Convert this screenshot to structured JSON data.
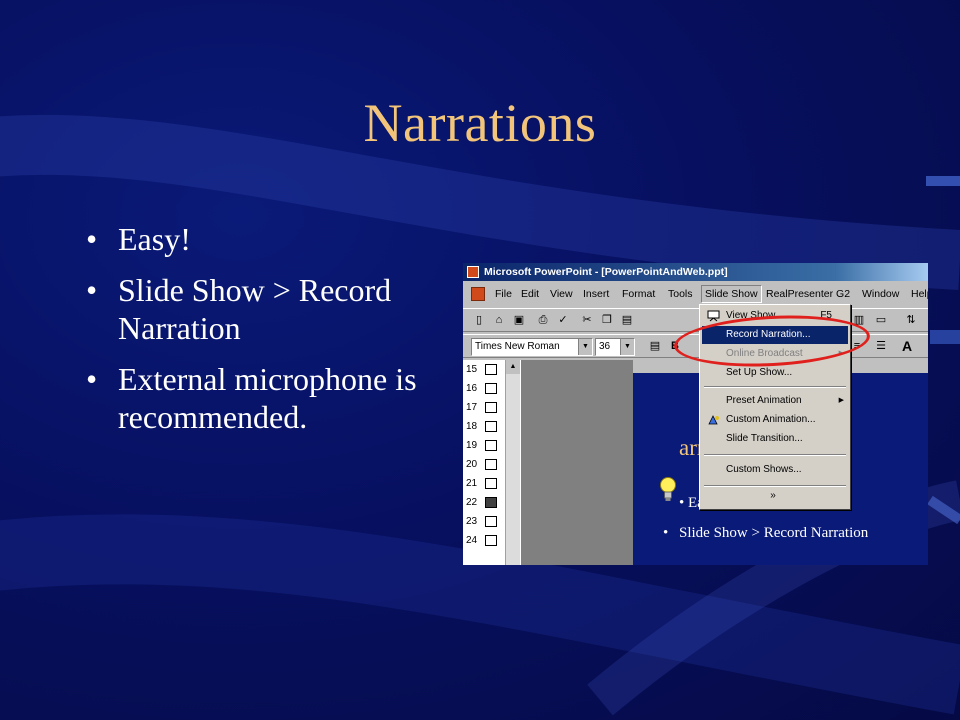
{
  "slide": {
    "title": "Narrations",
    "bullets": [
      {
        "bullet": "•",
        "text": "Easy!"
      },
      {
        "bullet": "•",
        "text": "Slide Show > Record Narration"
      },
      {
        "bullet": "•",
        "text": "External microphone is recommended."
      }
    ]
  },
  "screenshot": {
    "window_title": "Microsoft PowerPoint - [PowerPointAndWeb.ppt]",
    "menus": [
      "File",
      "Edit",
      "View",
      "Insert",
      "Format",
      "Tools",
      "Slide Show",
      "RealPresenter G2",
      "Window",
      "Help"
    ],
    "active_menu": "Slide Show",
    "font_name": "Times New Roman",
    "font_size": "36",
    "bold_label": "B",
    "grow_font_glyph": "A",
    "slide_numbers": [
      "15",
      "16",
      "17",
      "18",
      "19",
      "20",
      "21",
      "22",
      "23",
      "24"
    ],
    "selected_slide": "22",
    "dropdown": {
      "items": [
        {
          "label": "View Show",
          "shortcut": "F5",
          "state": "normal"
        },
        {
          "label": "Record Narration...",
          "state": "highlighted"
        },
        {
          "label": "Online Broadcast",
          "state": "disabled",
          "submenu": true
        },
        {
          "label": "Set Up Show...",
          "state": "normal"
        },
        {
          "label": "Preset Animation",
          "state": "normal",
          "submenu": true
        },
        {
          "label": "Custom Animation...",
          "state": "normal"
        },
        {
          "label": "Slide Transition...",
          "state": "normal"
        },
        {
          "label": "Custom Shows...",
          "state": "normal"
        }
      ],
      "more_glyph": "»"
    },
    "slide_preview": {
      "title": "arratio",
      "bullet1": "Easy!",
      "bullet2": "Slide Show > Record Narration",
      "bullet_glyph": "•"
    }
  },
  "colors": {
    "background": "#071060",
    "title": "#f2c57a",
    "text": "#ffffff",
    "menu_highlight": "#0a246a",
    "ring": "#e0201c"
  }
}
